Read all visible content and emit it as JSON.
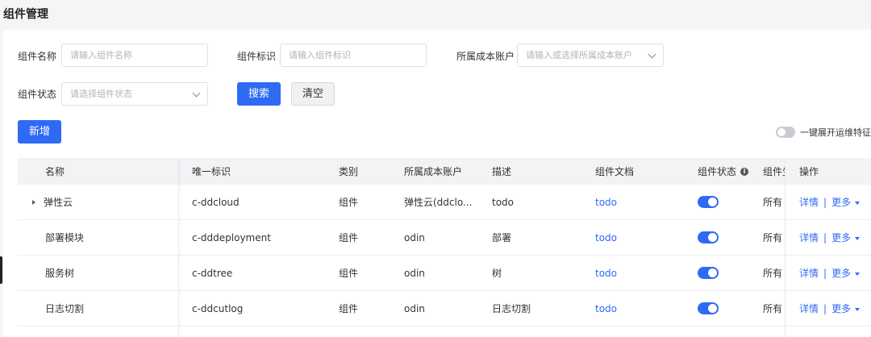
{
  "page": {
    "title": "组件管理"
  },
  "filters": {
    "name_label": "组件名称",
    "name_placeholder": "请输入组件名称",
    "id_label": "组件标识",
    "id_placeholder": "请输入组件标识",
    "account_label": "所属成本账户",
    "account_placeholder": "请输入或选择所属成本账户",
    "status_label": "组件状态",
    "status_placeholder": "请选择组件状态",
    "search_button": "搜索",
    "clear_button": "清空"
  },
  "toolbar": {
    "add_button": "新增",
    "expand_toggle_label": "一键展开运维特征"
  },
  "table": {
    "headers": {
      "name": "名称",
      "uid": "唯一标识",
      "category": "类别",
      "account": "所属成本账户",
      "desc": "描述",
      "doc": "组件文档",
      "status": "组件状态",
      "owner": "组件生",
      "ops": "操作"
    },
    "rows": [
      {
        "name": "弹性云",
        "uid": "c-ddcloud",
        "category": "组件",
        "account": "弹性云(ddclo...",
        "desc": "todo",
        "doc": "todo",
        "owner": "所有",
        "detail": "详情",
        "sep": "|",
        "more": "更多"
      },
      {
        "name": "部署模块",
        "uid": "c-dddeployment",
        "category": "组件",
        "account": "odin",
        "desc": "部署",
        "doc": "todo",
        "owner": "所有",
        "detail": "详情",
        "sep": "|",
        "more": "更多"
      },
      {
        "name": "服务树",
        "uid": "c-ddtree",
        "category": "组件",
        "account": "odin",
        "desc": "树",
        "doc": "todo",
        "owner": "所有",
        "detail": "详情",
        "sep": "|",
        "more": "更多"
      },
      {
        "name": "日志切割",
        "uid": "c-ddcutlog",
        "category": "组件",
        "account": "odin",
        "desc": "日志切割",
        "doc": "todo",
        "owner": "所有",
        "detail": "详情",
        "sep": "|",
        "more": "更多"
      }
    ]
  },
  "colors": {
    "primary": "#2f6af5",
    "header_bg": "#f2f3f5",
    "page_bg": "#f4f5f7"
  }
}
